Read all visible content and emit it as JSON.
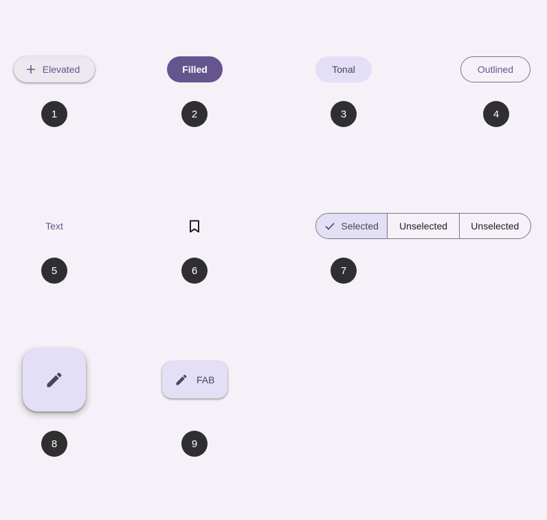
{
  "colors": {
    "background": "#f6f1f8",
    "primary": "#65558f",
    "secondary_container": "#e2dff6",
    "outline": "#79747e",
    "badge": "#2f2e30"
  },
  "buttons": {
    "elevated": {
      "label": "Elevated",
      "icon": "plus-icon"
    },
    "filled": {
      "label": "Filled"
    },
    "tonal": {
      "label": "Tonal"
    },
    "outlined": {
      "label": "Outlined"
    },
    "text": {
      "label": "Text"
    },
    "icon_button": {
      "icon": "bookmark-icon"
    }
  },
  "segmented": {
    "segments": [
      {
        "label": "Selected",
        "selected": true,
        "icon": "check-icon"
      },
      {
        "label": "Unselected",
        "selected": false
      },
      {
        "label": "Unselected",
        "selected": false
      }
    ]
  },
  "fabs": {
    "large": {
      "icon": "pencil-icon"
    },
    "extended": {
      "label": "FAB",
      "icon": "pencil-icon"
    }
  },
  "badges": [
    "1",
    "2",
    "3",
    "4",
    "5",
    "6",
    "7",
    "8",
    "9"
  ]
}
